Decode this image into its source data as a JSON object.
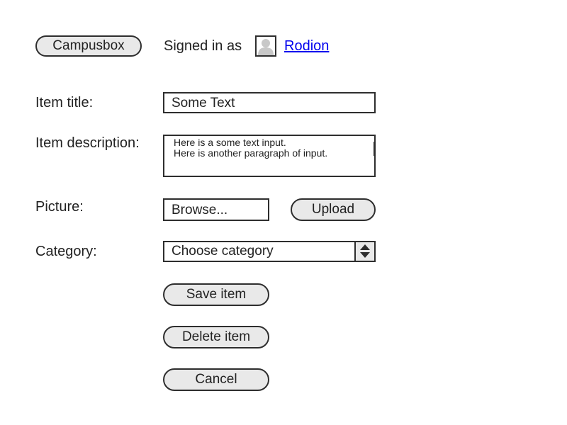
{
  "header": {
    "app_button_label": "Campusbox",
    "signed_in_text": "Signed in as",
    "user": {
      "name": "Rodion",
      "avatar_icon": "user-avatar-icon"
    },
    "link_color": "#0000ee"
  },
  "form": {
    "title": {
      "label": "Item title:",
      "value": "Some Text"
    },
    "description": {
      "label": "Item description:",
      "paragraphs": [
        "Here is a some text input.",
        "Here is another paragraph of input."
      ]
    },
    "picture": {
      "label": "Picture:",
      "browse_label": "Browse...",
      "upload_label": "Upload"
    },
    "category": {
      "label": "Category:",
      "selected": "Choose category",
      "stepper_icon": "up-down-stepper-icon"
    }
  },
  "actions": {
    "save_label": "Save item",
    "delete_label": "Delete item",
    "cancel_label": "Cancel"
  }
}
